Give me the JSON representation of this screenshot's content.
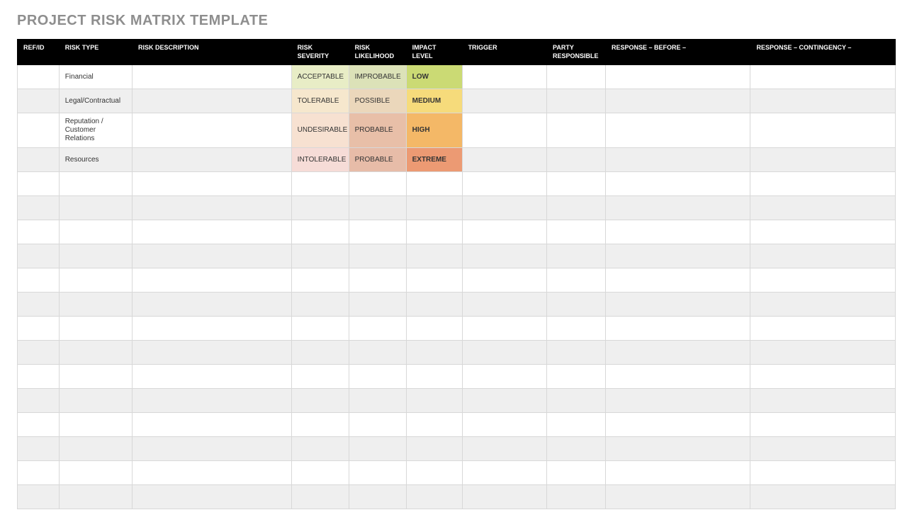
{
  "title": "PROJECT RISK MATRIX TEMPLATE",
  "headers": {
    "ref_id": "REF/ID",
    "risk_type": "RISK TYPE",
    "risk_description": "RISK DESCRIPTION",
    "risk_severity": "RISK SEVERITY",
    "risk_likelihood": "RISK LIKELIHOOD",
    "impact_level": "IMPACT LEVEL",
    "trigger": "TRIGGER",
    "party_responsible": "PARTY RESPONSIBLE",
    "response_before": "RESPONSE – BEFORE –",
    "response_contingency": "RESPONSE – CONTINGENCY –"
  },
  "rows": [
    {
      "ref_id": "",
      "risk_type": "Financial",
      "risk_description": "",
      "risk_severity": "ACCEPTABLE",
      "risk_likelihood": "IMPROBABLE",
      "impact_level": "LOW",
      "trigger": "",
      "party_responsible": "",
      "response_before": "",
      "response_contingency": ""
    },
    {
      "ref_id": "",
      "risk_type": "Legal/Contractual",
      "risk_description": "",
      "risk_severity": "TOLERABLE",
      "risk_likelihood": "POSSIBLE",
      "impact_level": "MEDIUM",
      "trigger": "",
      "party_responsible": "",
      "response_before": "",
      "response_contingency": ""
    },
    {
      "ref_id": "",
      "risk_type": "Reputation / Customer Relations",
      "risk_description": "",
      "risk_severity": "UNDESIRABLE",
      "risk_likelihood": "PROBABLE",
      "impact_level": "HIGH",
      "trigger": "",
      "party_responsible": "",
      "response_before": "",
      "response_contingency": ""
    },
    {
      "ref_id": "",
      "risk_type": "Resources",
      "risk_description": "",
      "risk_severity": "INTOLERABLE",
      "risk_likelihood": "PROBABLE",
      "impact_level": "EXTREME",
      "trigger": "",
      "party_responsible": "",
      "response_before": "",
      "response_contingency": ""
    }
  ],
  "empty_row_count": 14,
  "chart_data": {
    "type": "table",
    "title": "PROJECT RISK MATRIX TEMPLATE",
    "columns": [
      "REF/ID",
      "RISK TYPE",
      "RISK DESCRIPTION",
      "RISK SEVERITY",
      "RISK LIKELIHOOD",
      "IMPACT LEVEL",
      "TRIGGER",
      "PARTY RESPONSIBLE",
      "RESPONSE – BEFORE –",
      "RESPONSE – CONTINGENCY –"
    ],
    "rows": [
      [
        "",
        "Financial",
        "",
        "ACCEPTABLE",
        "IMPROBABLE",
        "LOW",
        "",
        "",
        "",
        ""
      ],
      [
        "",
        "Legal/Contractual",
        "",
        "TOLERABLE",
        "POSSIBLE",
        "MEDIUM",
        "",
        "",
        "",
        ""
      ],
      [
        "",
        "Reputation / Customer Relations",
        "",
        "UNDESIRABLE",
        "PROBABLE",
        "HIGH",
        "",
        "",
        "",
        ""
      ],
      [
        "",
        "Resources",
        "",
        "INTOLERABLE",
        "PROBABLE",
        "EXTREME",
        "",
        "",
        "",
        ""
      ]
    ],
    "severity_scale": [
      "ACCEPTABLE",
      "TOLERABLE",
      "UNDESIRABLE",
      "INTOLERABLE"
    ],
    "likelihood_scale": [
      "IMPROBABLE",
      "POSSIBLE",
      "PROBABLE"
    ],
    "impact_scale": [
      "LOW",
      "MEDIUM",
      "HIGH",
      "EXTREME"
    ],
    "colors": {
      "severity": {
        "ACCEPTABLE": "#e8edc6",
        "TOLERABLE": "#f6e7cd",
        "UNDESIRABLE": "#f7e1d1",
        "INTOLERABLE": "#f6dcd7"
      },
      "likelihood": {
        "IMPROBABLE": "#dce2b8",
        "POSSIBLE": "#ebd7bb",
        "PROBABLE": "#e8bfa8"
      },
      "impact": {
        "LOW": "#cbda74",
        "MEDIUM": "#f6db7b",
        "HIGH": "#f4b867",
        "EXTREME": "#ec9a73"
      }
    }
  }
}
